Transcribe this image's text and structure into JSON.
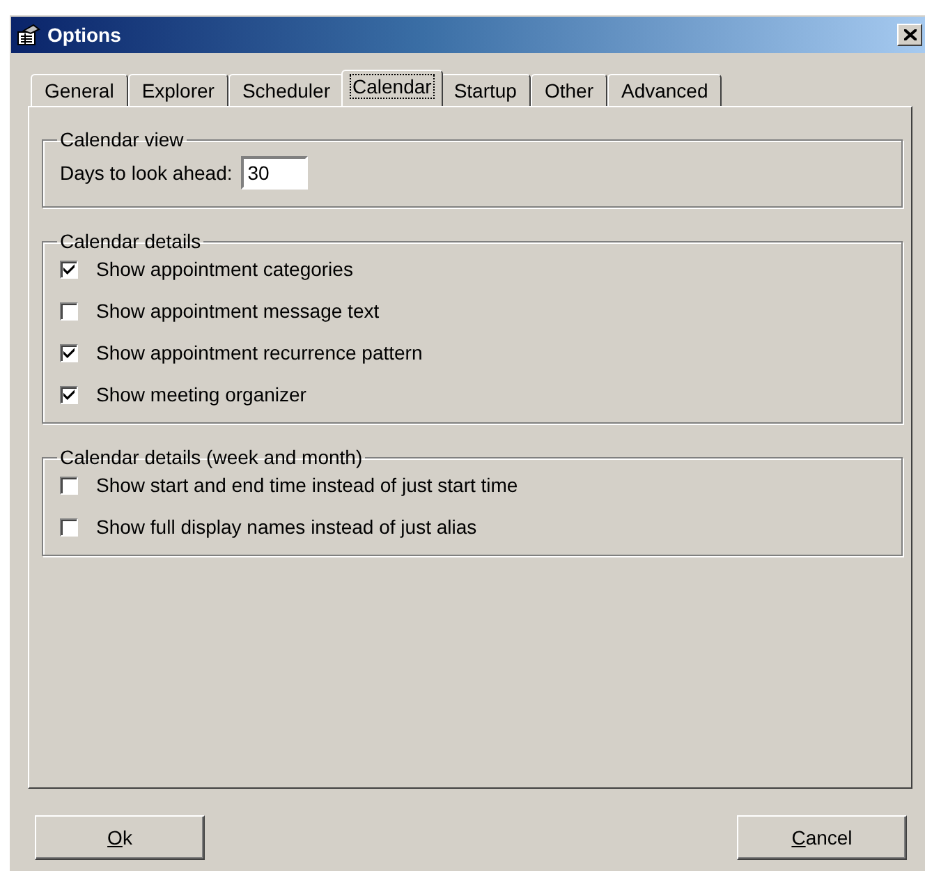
{
  "window": {
    "title": "Options"
  },
  "tabs": [
    {
      "label": "General",
      "selected": false
    },
    {
      "label": "Explorer",
      "selected": false
    },
    {
      "label": "Scheduler",
      "selected": false
    },
    {
      "label": "Calendar",
      "selected": true
    },
    {
      "label": "Startup",
      "selected": false
    },
    {
      "label": "Other",
      "selected": false
    },
    {
      "label": "Advanced",
      "selected": false
    }
  ],
  "calendar_view": {
    "title": "Calendar view",
    "days_label": "Days to look ahead:",
    "days_value": "30"
  },
  "calendar_details": {
    "title": "Calendar details",
    "options": [
      {
        "label": "Show appointment categories",
        "checked": true
      },
      {
        "label": "Show appointment message text",
        "checked": false
      },
      {
        "label": "Show appointment recurrence pattern",
        "checked": true
      },
      {
        "label": "Show meeting organizer",
        "checked": true
      }
    ]
  },
  "week_month_details": {
    "title": "Calendar details (week and month)",
    "options": [
      {
        "label": "Show start and end time instead of just start time",
        "checked": false
      },
      {
        "label": "Show full display names instead of just alias",
        "checked": false
      }
    ]
  },
  "buttons": [
    {
      "label": "Ok",
      "mnemonic": true
    },
    {
      "label": "Cancel",
      "mnemonic": true
    }
  ]
}
